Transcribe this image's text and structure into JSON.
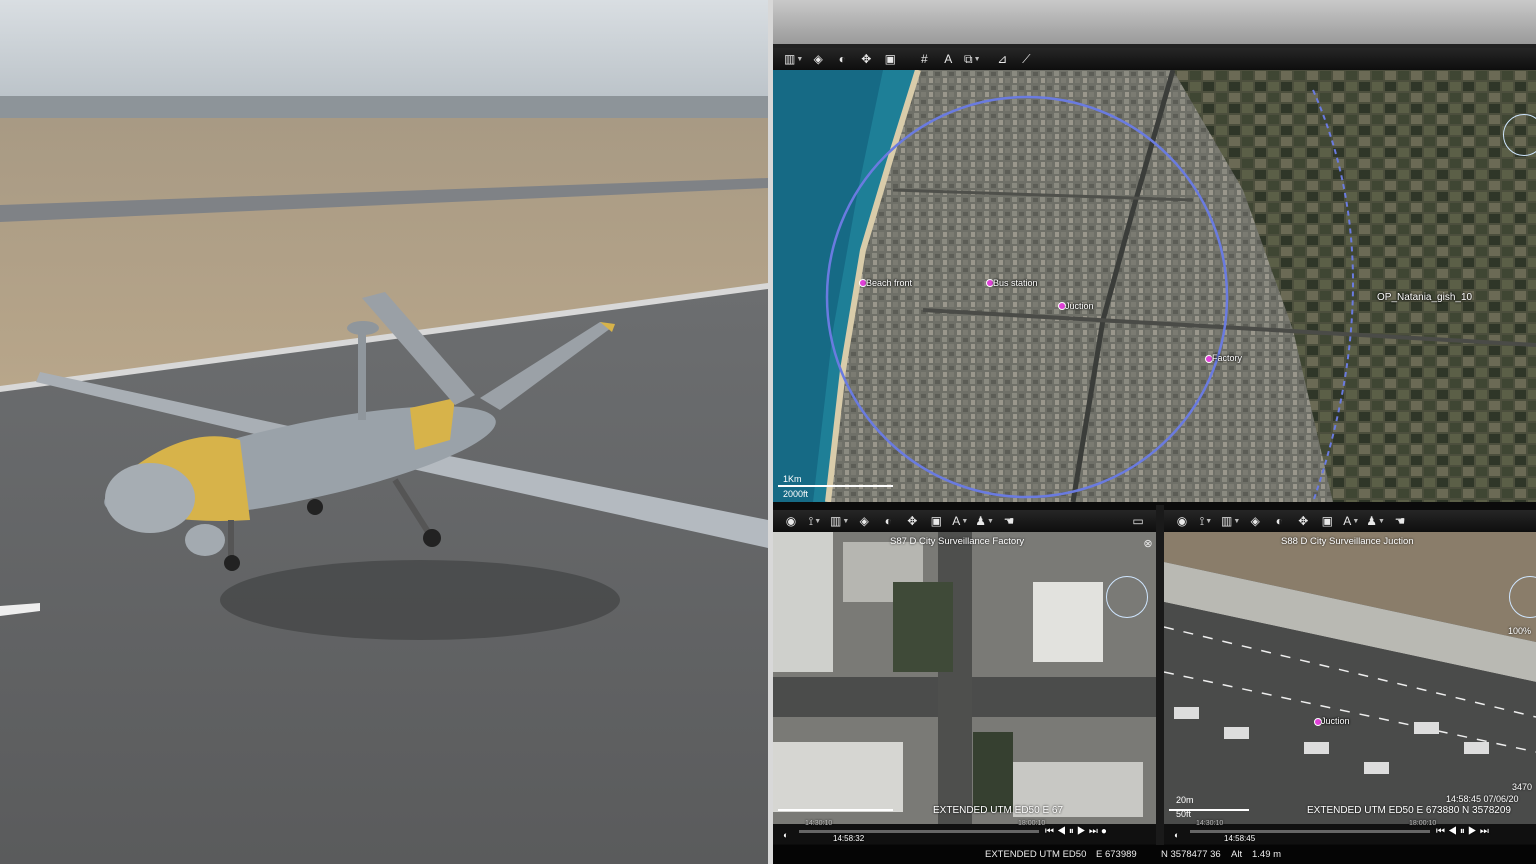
{
  "main_map": {
    "toolbar_icons": [
      "map-icon",
      "layers-icon",
      "contrast-icon",
      "expand-icon",
      "camera-icon",
      "grid-icon",
      "text-icon",
      "overlay-icon",
      "measure-icon",
      "ruler-icon"
    ],
    "labels": {
      "beach": "Beach front",
      "bus": "Bus station",
      "juction": "Juction",
      "factory": "Factory",
      "op": "OP_Natania_gish_10"
    },
    "scale_km": "1Km",
    "scale_ft": "2000ft",
    "accent_color": "#6a7be0"
  },
  "video_left": {
    "title": "S87 D City Surveillance Factory",
    "coord": "EXTENDED UTM ED50   E 67",
    "time_start": "14:30:10",
    "time_end": "18:00:10",
    "time_cursor": "14:58:32"
  },
  "video_right": {
    "title": "S88 D City Surveillance Juction",
    "label": "Juction",
    "scale_m": "20m",
    "scale_ft": "50ft",
    "zoom": "100%",
    "alt": "3470",
    "timestamp": "14:58:45 07/06/20",
    "coord": "EXTENDED UTM ED50   E 673880   N 3578209",
    "time_start": "14:30:10",
    "time_end": "18:00:10",
    "time_cursor": "14:58:45"
  },
  "status": {
    "datum": "EXTENDED UTM ED50",
    "easting": "E  673989",
    "northing": "N  3578477 36",
    "alt_label": "Alt",
    "alt_value": "1.49 m"
  }
}
